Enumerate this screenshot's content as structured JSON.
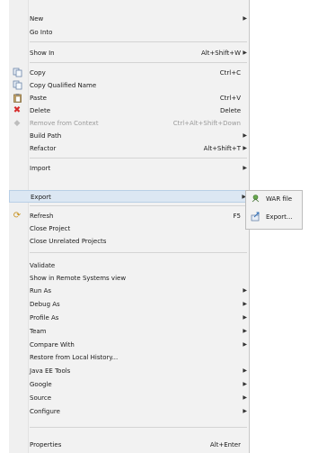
{
  "menu": {
    "items": [
      {
        "label": "New",
        "shortcut": "",
        "submenu": true,
        "icon": "",
        "disabled": false
      },
      {
        "label": "Go Into",
        "shortcut": "",
        "submenu": false,
        "icon": "",
        "disabled": false
      },
      {
        "label": "Show In",
        "shortcut": "Alt+Shift+W",
        "submenu": true,
        "icon": "",
        "disabled": false
      },
      {
        "label": "Copy",
        "shortcut": "Ctrl+C",
        "submenu": false,
        "icon": "copy-icon",
        "disabled": false
      },
      {
        "label": "Copy Qualified Name",
        "shortcut": "",
        "submenu": false,
        "icon": "copy-qualified-icon",
        "disabled": false
      },
      {
        "label": "Paste",
        "shortcut": "Ctrl+V",
        "submenu": false,
        "icon": "paste-icon",
        "disabled": false
      },
      {
        "label": "Delete",
        "shortcut": "Delete",
        "submenu": false,
        "icon": "delete-x-icon",
        "disabled": false
      },
      {
        "label": "Remove from Context",
        "shortcut": "Ctrl+Alt+Shift+Down",
        "submenu": false,
        "icon": "remove-context-icon",
        "disabled": true
      },
      {
        "label": "Build Path",
        "shortcut": "",
        "submenu": true,
        "icon": "",
        "disabled": false
      },
      {
        "label": "Refactor",
        "shortcut": "Alt+Shift+T",
        "submenu": true,
        "icon": "",
        "disabled": false
      },
      {
        "label": "Import",
        "shortcut": "",
        "submenu": true,
        "icon": "",
        "disabled": false
      },
      {
        "label": "Export",
        "shortcut": "",
        "submenu": true,
        "icon": "",
        "disabled": false
      },
      {
        "label": "Refresh",
        "shortcut": "F5",
        "submenu": false,
        "icon": "refresh-icon",
        "disabled": false
      },
      {
        "label": "Close Project",
        "shortcut": "",
        "submenu": false,
        "icon": "",
        "disabled": false
      },
      {
        "label": "Close Unrelated Projects",
        "shortcut": "",
        "submenu": false,
        "icon": "",
        "disabled": false
      },
      {
        "label": "Validate",
        "shortcut": "",
        "submenu": false,
        "icon": "",
        "disabled": false
      },
      {
        "label": "Show in Remote Systems view",
        "shortcut": "",
        "submenu": false,
        "icon": "",
        "disabled": false
      },
      {
        "label": "Run As",
        "shortcut": "",
        "submenu": true,
        "icon": "",
        "disabled": false
      },
      {
        "label": "Debug As",
        "shortcut": "",
        "submenu": true,
        "icon": "",
        "disabled": false
      },
      {
        "label": "Profile As",
        "shortcut": "",
        "submenu": true,
        "icon": "",
        "disabled": false
      },
      {
        "label": "Team",
        "shortcut": "",
        "submenu": true,
        "icon": "",
        "disabled": false
      },
      {
        "label": "Compare With",
        "shortcut": "",
        "submenu": true,
        "icon": "",
        "disabled": false
      },
      {
        "label": "Restore from Local History...",
        "shortcut": "",
        "submenu": false,
        "icon": "",
        "disabled": false
      },
      {
        "label": "Java EE Tools",
        "shortcut": "",
        "submenu": true,
        "icon": "",
        "disabled": false
      },
      {
        "label": "Google",
        "shortcut": "",
        "submenu": true,
        "icon": "",
        "disabled": false
      },
      {
        "label": "Source",
        "shortcut": "",
        "submenu": true,
        "icon": "",
        "disabled": false
      },
      {
        "label": "Configure",
        "shortcut": "",
        "submenu": true,
        "icon": "",
        "disabled": false
      },
      {
        "label": "Properties",
        "shortcut": "Alt+Enter",
        "submenu": false,
        "icon": "",
        "disabled": false
      }
    ]
  },
  "submenu": {
    "items": [
      {
        "label": "WAR file",
        "icon": "war-file-icon"
      },
      {
        "label": "Export...",
        "icon": "export-icon"
      }
    ]
  },
  "colors": {
    "highlight": "#dce7f3",
    "delete_icon": "#d62b2b",
    "disabled_text": "#9a9a9a"
  }
}
